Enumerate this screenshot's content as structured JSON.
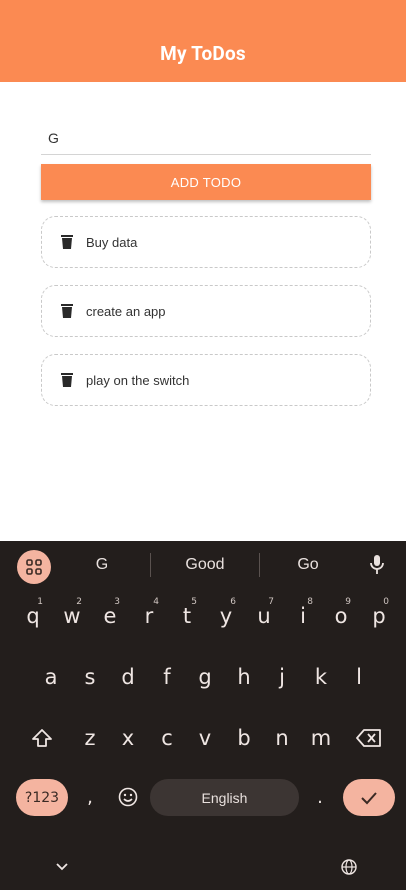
{
  "app": {
    "title": "My ToDos"
  },
  "input": {
    "value": "G"
  },
  "add_button": {
    "label": "ADD TODO"
  },
  "todos": [
    {
      "text": "Buy data"
    },
    {
      "text": "create an app"
    },
    {
      "text": "play on the switch"
    }
  ],
  "keyboard": {
    "suggestions": [
      "G",
      "Good",
      "Go"
    ],
    "row1": [
      {
        "k": "q",
        "h": "1"
      },
      {
        "k": "w",
        "h": "2"
      },
      {
        "k": "e",
        "h": "3"
      },
      {
        "k": "r",
        "h": "4"
      },
      {
        "k": "t",
        "h": "5"
      },
      {
        "k": "y",
        "h": "6"
      },
      {
        "k": "u",
        "h": "7"
      },
      {
        "k": "i",
        "h": "8"
      },
      {
        "k": "o",
        "h": "9"
      },
      {
        "k": "p",
        "h": "0"
      }
    ],
    "row2": [
      "a",
      "s",
      "d",
      "f",
      "g",
      "h",
      "j",
      "k",
      "l"
    ],
    "row3": [
      "z",
      "x",
      "c",
      "v",
      "b",
      "n",
      "m"
    ],
    "symbols_label": "?123",
    "comma": ",",
    "period": ".",
    "space_label": "English",
    "colors": {
      "background": "#231e1c",
      "accent": "#f4b4a0",
      "app_bar": "#fb8a52"
    },
    "icons": [
      "apps-grid-icon",
      "mic-icon",
      "shift-icon",
      "backspace-icon",
      "emoji-icon",
      "checkmark-icon",
      "chevron-down-icon",
      "globe-icon",
      "trash-icon"
    ]
  }
}
